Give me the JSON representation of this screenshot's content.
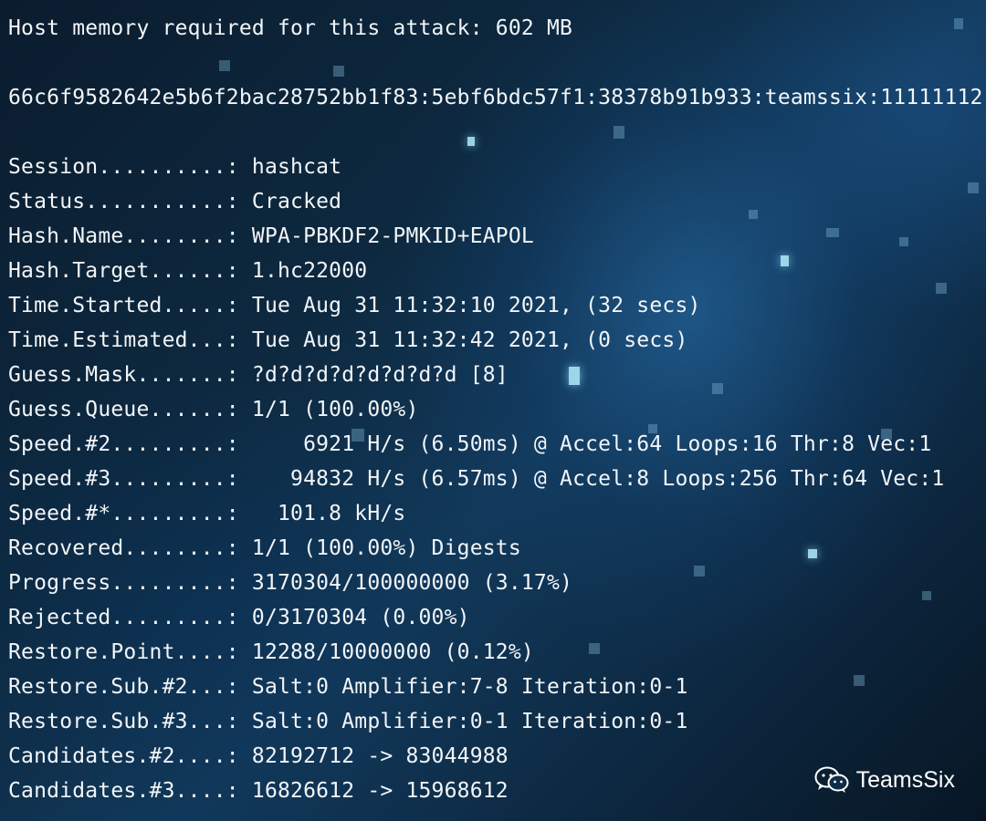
{
  "terminal": {
    "memory_line": "Host memory required for this attack: 602 MB",
    "hash_line": "66c6f9582642e5b6f2bac28752bb1f83:5ebf6bdc57f1:38378b91b933:teamssix:11111112",
    "status_lines": [
      "Session..........: hashcat",
      "Status...........: Cracked",
      "Hash.Name........: WPA-PBKDF2-PMKID+EAPOL",
      "Hash.Target......: 1.hc22000",
      "Time.Started.....: Tue Aug 31 11:32:10 2021, (32 secs)",
      "Time.Estimated...: Tue Aug 31 11:32:42 2021, (0 secs)",
      "Guess.Mask.......: ?d?d?d?d?d?d?d?d [8]",
      "Guess.Queue......: 1/1 (100.00%)",
      "Speed.#2.........:     6921 H/s (6.50ms) @ Accel:64 Loops:16 Thr:8 Vec:1",
      "Speed.#3.........:    94832 H/s (6.57ms) @ Accel:8 Loops:256 Thr:64 Vec:1",
      "Speed.#*.........:   101.8 kH/s",
      "Recovered........: 1/1 (100.00%) Digests",
      "Progress.........: 3170304/100000000 (3.17%)",
      "Rejected.........: 0/3170304 (0.00%)",
      "Restore.Point....: 12288/10000000 (0.12%)",
      "Restore.Sub.#2...: Salt:0 Amplifier:7-8 Iteration:0-1",
      "Restore.Sub.#3...: Salt:0 Amplifier:0-1 Iteration:0-1",
      "Candidates.#2....: 82192712 -> 83044988",
      "Candidates.#3....: 16826612 -> 15968612"
    ]
  },
  "watermark": {
    "icon": "wechat-icon",
    "text": "TeamsSix"
  }
}
